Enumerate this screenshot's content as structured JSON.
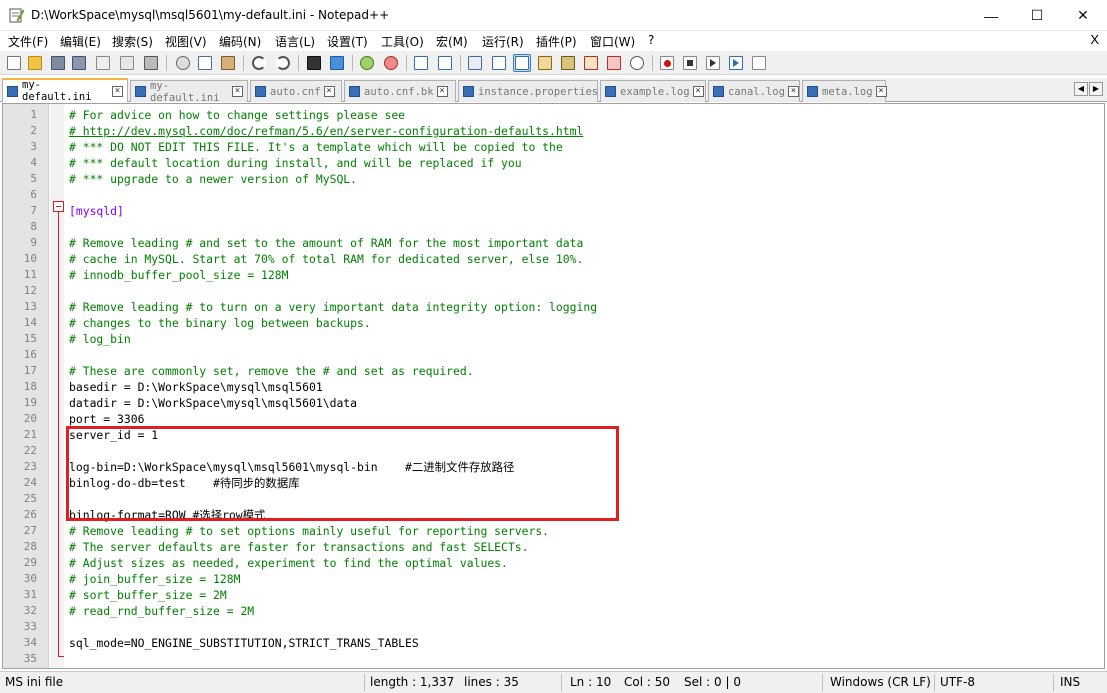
{
  "window": {
    "title": "D:\\WorkSpace\\mysql\\msql5601\\my-default.ini - Notepad++",
    "minimize": "—",
    "maximize": "☐",
    "close": "✕"
  },
  "menu": {
    "items": [
      "文件(F)",
      "编辑(E)",
      "搜索(S)",
      "视图(V)",
      "编码(N)",
      "语言(L)",
      "设置(T)",
      "工具(O)",
      "宏(M)",
      "运行(R)",
      "插件(P)",
      "窗口(W)",
      "?"
    ],
    "close": "X"
  },
  "toolbar": {
    "icons": [
      "new-file-icon",
      "open-file-icon",
      "save-icon",
      "save-all-icon",
      "close-file-icon",
      "close-all-icon",
      "print-icon",
      "cut-icon",
      "copy-icon",
      "paste-icon",
      "undo-icon",
      "redo-icon",
      "find-icon",
      "replace-icon",
      "zoom-in-icon",
      "zoom-out-icon",
      "sync-vertical-icon",
      "sync-horizontal-icon",
      "word-wrap-icon",
      "show-all-chars-icon",
      "indent-guide-icon",
      "user-lang-icon",
      "doc-map-icon",
      "function-list-icon",
      "folder-workspace-icon",
      "monitor-icon",
      "record-macro-icon",
      "stop-record-icon",
      "play-macro-icon",
      "run-macro-multiple-icon",
      "save-macro-icon"
    ]
  },
  "tabs": [
    {
      "label": "my-default.ini",
      "active": true
    },
    {
      "label": "my-default.ini",
      "active": false
    },
    {
      "label": "auto.cnf",
      "active": false
    },
    {
      "label": "auto.cnf.bk",
      "active": false
    },
    {
      "label": "instance.properties",
      "active": false
    },
    {
      "label": "example.log",
      "active": false
    },
    {
      "label": "canal.log",
      "active": false
    },
    {
      "label": "meta.log",
      "active": false
    }
  ],
  "tab_nav": {
    "left": "◀",
    "right": "▶"
  },
  "editor": {
    "lines": [
      {
        "n": "1",
        "text": "# For advice on how to change settings please see",
        "type": "comment"
      },
      {
        "n": "2",
        "text": "# http://dev.mysql.com/doc/refman/5.6/en/server-configuration-defaults.html",
        "type": "link"
      },
      {
        "n": "3",
        "text": "# *** DO NOT EDIT THIS FILE. It's a template which will be copied to the",
        "type": "comment"
      },
      {
        "n": "4",
        "text": "# *** default location during install, and will be replaced if you",
        "type": "comment"
      },
      {
        "n": "5",
        "text": "# *** upgrade to a newer version of MySQL.",
        "type": "comment"
      },
      {
        "n": "6",
        "text": "",
        "type": "blank"
      },
      {
        "n": "7",
        "text": "[mysqld]",
        "type": "section"
      },
      {
        "n": "8",
        "text": "",
        "type": "blank"
      },
      {
        "n": "9",
        "text": "# Remove leading # and set to the amount of RAM for the most important data",
        "type": "comment"
      },
      {
        "n": "10",
        "text": "# cache in MySQL. Start at 70% of total RAM for dedicated server, else 10%.",
        "type": "comment"
      },
      {
        "n": "11",
        "text": "# innodb_buffer_pool_size = 128M",
        "type": "comment"
      },
      {
        "n": "12",
        "text": "",
        "type": "blank"
      },
      {
        "n": "13",
        "text": "# Remove leading # to turn on a very important data integrity option: logging",
        "type": "comment"
      },
      {
        "n": "14",
        "text": "# changes to the binary log between backups.",
        "type": "comment"
      },
      {
        "n": "15",
        "text": "# log_bin",
        "type": "comment"
      },
      {
        "n": "16",
        "text": "",
        "type": "blank"
      },
      {
        "n": "17",
        "text": "# These are commonly set, remove the # and set as required.",
        "type": "comment"
      },
      {
        "n": "18",
        "text": "basedir = D:\\WorkSpace\\mysql\\msql5601",
        "type": "kv"
      },
      {
        "n": "19",
        "text": "datadir = D:\\WorkSpace\\mysql\\msql5601\\data",
        "type": "kv"
      },
      {
        "n": "20",
        "text": "port = 3306",
        "type": "kv"
      },
      {
        "n": "21",
        "text": "server_id = 1",
        "type": "kv"
      },
      {
        "n": "22",
        "text": "",
        "type": "blank"
      },
      {
        "n": "23",
        "text": "log-bin=D:\\WorkSpace\\mysql\\msql5601\\mysql-bin    #二进制文件存放路径",
        "type": "kv"
      },
      {
        "n": "24",
        "text": "binlog-do-db=test    #待同步的数据库",
        "type": "kv"
      },
      {
        "n": "25",
        "text": "",
        "type": "blank"
      },
      {
        "n": "26",
        "text": "binlog-format=ROW #选择row模式",
        "type": "kv"
      },
      {
        "n": "27",
        "text": "# Remove leading # to set options mainly useful for reporting servers.",
        "type": "comment"
      },
      {
        "n": "28",
        "text": "# The server defaults are faster for transactions and fast SELECTs.",
        "type": "comment"
      },
      {
        "n": "29",
        "text": "# Adjust sizes as needed, experiment to find the optimal values.",
        "type": "comment"
      },
      {
        "n": "30",
        "text": "# join_buffer_size = 128M",
        "type": "comment"
      },
      {
        "n": "31",
        "text": "# sort_buffer_size = 2M",
        "type": "comment"
      },
      {
        "n": "32",
        "text": "# read_rnd_buffer_size = 2M",
        "type": "comment"
      },
      {
        "n": "33",
        "text": "",
        "type": "blank"
      },
      {
        "n": "34",
        "text": "sql_mode=NO_ENGINE_SUBSTITUTION,STRICT_TRANS_TABLES",
        "type": "kv"
      },
      {
        "n": "35",
        "text": "",
        "type": "blank"
      }
    ]
  },
  "status": {
    "file_type": "MS ini file",
    "length": "length : 1,337",
    "lines": "lines : 35",
    "ln": "Ln : 10",
    "col": "Col : 50",
    "sel": "Sel : 0 | 0",
    "eol": "Windows (CR LF)",
    "encoding": "UTF-8",
    "mode": "INS"
  },
  "colors": {
    "comment": "#008000",
    "section": "#8000ff",
    "fold": "#d21f1f",
    "highlight_box": "#e02020",
    "active_tab_accent": "#f9b43a"
  }
}
